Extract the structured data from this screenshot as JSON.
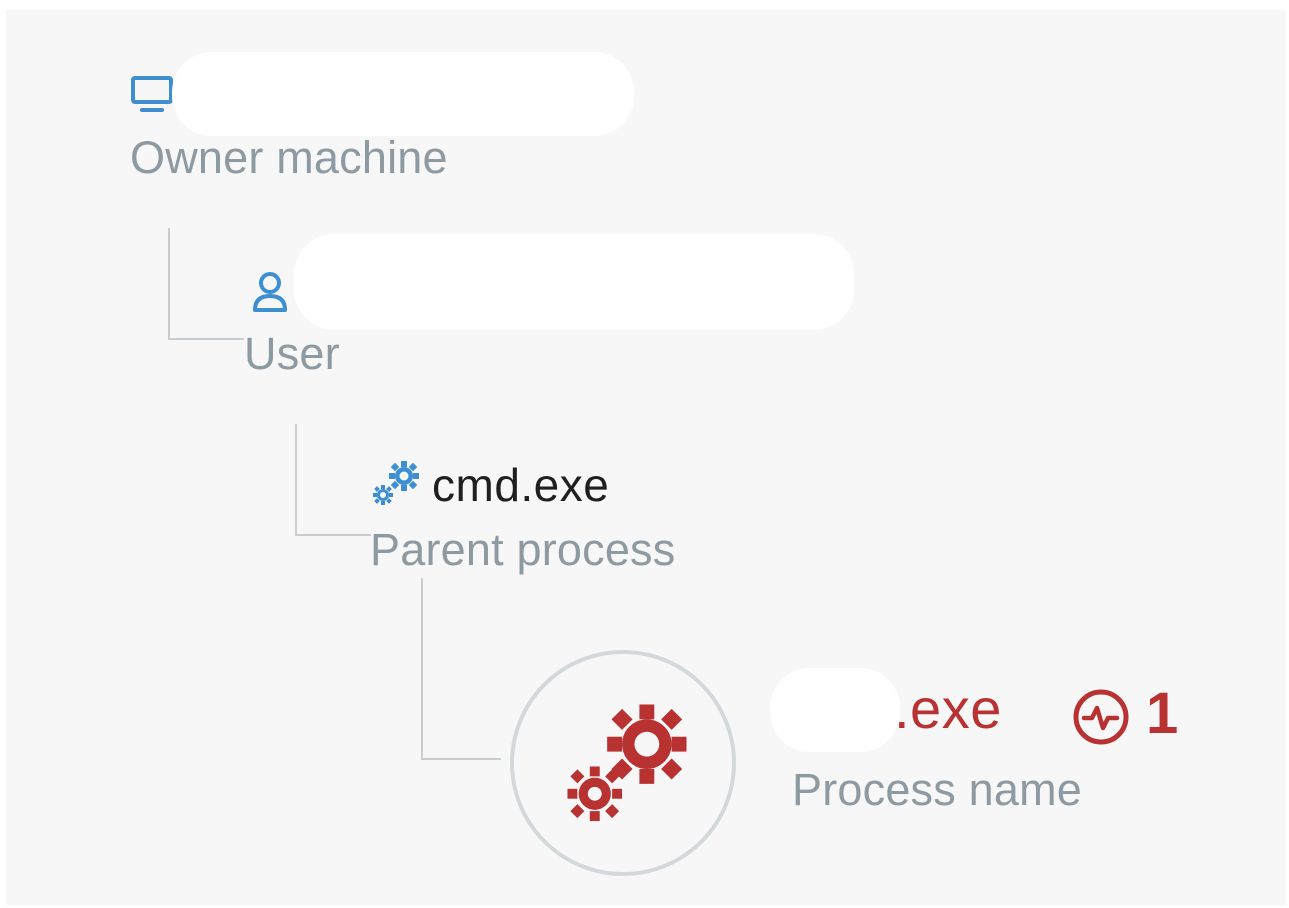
{
  "tree": {
    "owner_machine": {
      "icon": "computer-icon",
      "value": "",
      "label": "Owner machine"
    },
    "user": {
      "icon": "user-icon",
      "value": "",
      "label": "User"
    },
    "parent_process": {
      "icon": "gears-icon",
      "value": "cmd.exe",
      "label": "Parent process"
    },
    "process": {
      "icon": "gears-icon",
      "value": ".exe",
      "label": "Process name",
      "alert_icon": "activity-alert-icon",
      "alert_count": "1"
    }
  },
  "colors": {
    "panel_bg": "#f7f7f8",
    "label_gray": "#8e9aa2",
    "icon_blue": "#3d8fd1",
    "alert_red": "#b83232",
    "text_dark": "#1f1f1f",
    "connector": "#c8cdd1"
  }
}
